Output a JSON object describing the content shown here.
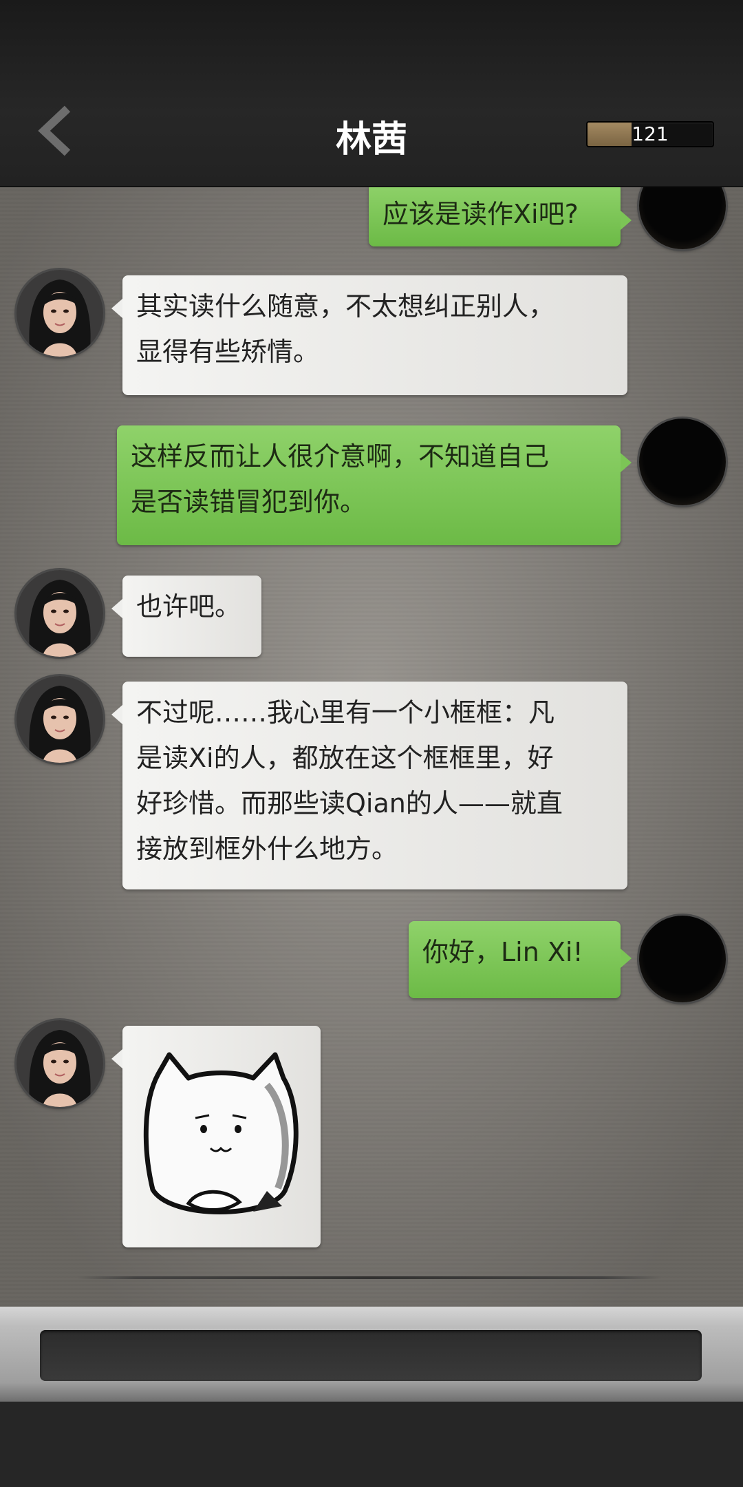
{
  "header": {
    "title": "林茜",
    "score": "121",
    "score_fill_fraction": 0.35
  },
  "messages": [
    {
      "side": "right",
      "text": "应该是读作Xi吧?"
    },
    {
      "side": "left",
      "lines": [
        "其实读什么随意，不太想纠正别人，",
        "显得有些矫情。"
      ]
    },
    {
      "side": "right",
      "lines": [
        "这样反而让人很介意啊，不知道自己",
        "是否读错冒犯到你。"
      ]
    },
    {
      "side": "left",
      "text": "也许吧。"
    },
    {
      "side": "left",
      "lines": [
        "不过呢……我心里有一个小框框：凡",
        "是读Xi的人，都放在这个框框里，好",
        "好珍惜。而那些读Qian的人——就直",
        "接放到框外什么地方。"
      ]
    },
    {
      "side": "right",
      "text": "你好，Lin Xi!"
    },
    {
      "side": "left",
      "sticker": "cat-sticker"
    }
  ],
  "icons": {
    "back": "chevron-left-icon"
  },
  "colors": {
    "green_bubble": "#7cc556",
    "white_bubble": "#efefed",
    "score_fill": "#9a8058"
  }
}
